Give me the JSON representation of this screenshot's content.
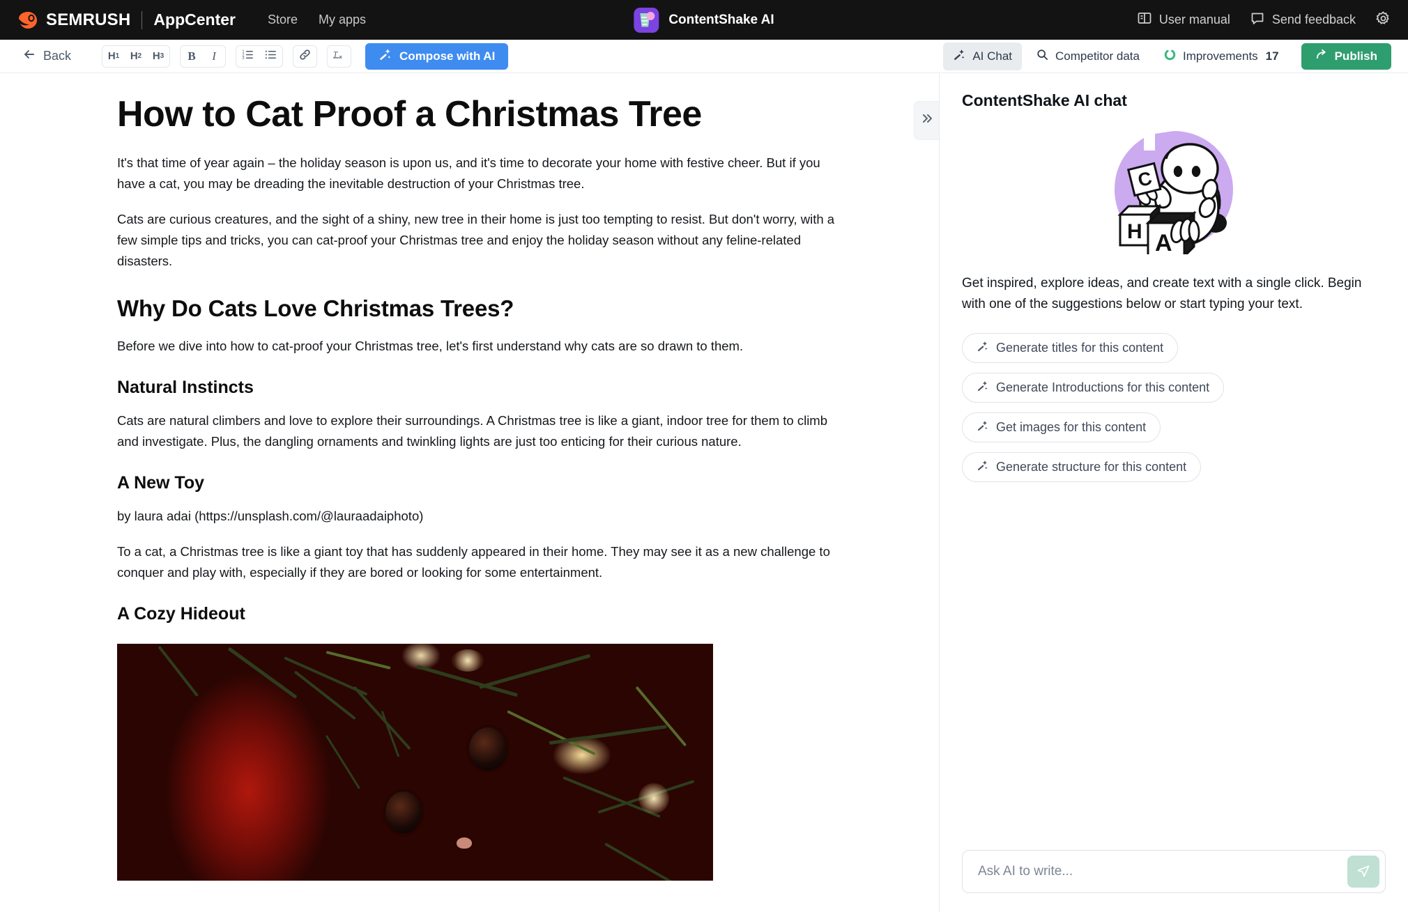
{
  "topnav": {
    "brand_word": "SEMRUSH",
    "appcenter": "AppCenter",
    "links": [
      {
        "label": "Store",
        "name": "nav-link-store"
      },
      {
        "label": "My apps",
        "name": "nav-link-my-apps"
      }
    ],
    "app_title": "ContentShake AI",
    "right_items": [
      {
        "label": "User manual",
        "icon": "book-icon"
      },
      {
        "label": "Send feedback",
        "icon": "comment-icon"
      }
    ],
    "settings_icon": "gear-icon",
    "app_icon_colors": {
      "bg": "#7b43e0",
      "cup": "#9fd9c3",
      "dot": "#f5a8e0"
    }
  },
  "toolbar": {
    "back_label": "Back",
    "heading_buttons": [
      {
        "label": "H",
        "sub": "1"
      },
      {
        "label": "H",
        "sub": "2"
      },
      {
        "label": "H",
        "sub": "3"
      }
    ],
    "format_buttons": [
      {
        "label": "B",
        "name": "bold-button"
      },
      {
        "label": "I",
        "name": "italic-button"
      }
    ],
    "list_buttons": [
      {
        "icon": "ordered-list-icon"
      },
      {
        "icon": "bullet-list-icon"
      }
    ],
    "link_button": {
      "icon": "link-icon"
    },
    "clear_format_button": {
      "icon": "clear-formatting-icon"
    },
    "compose_label": "Compose with AI",
    "compose_icon": "magic-wand-icon",
    "ai_chat_label": "AI Chat",
    "competitor_data_label": "Competitor data",
    "improvements_label": "Improvements",
    "improvements_count": "17",
    "publish_label": "Publish",
    "accent_blue": "#3f8cf0",
    "accent_green": "#2f9e6f"
  },
  "document": {
    "title": "How to Cat Proof a Christmas Tree",
    "blocks": [
      {
        "type": "p",
        "text": "It's that time of year again – the holiday season is upon us, and it's time to decorate your home with festive cheer. But if you have a cat, you may be dreading the inevitable destruction of your Christmas tree."
      },
      {
        "type": "p",
        "text": "Cats are curious creatures, and the sight of a shiny, new tree in their home is just too tempting to resist. But don't worry, with a few simple tips and tricks, you can cat-proof your Christmas tree and enjoy the holiday season without any feline-related disasters."
      },
      {
        "type": "h2",
        "text": "Why Do Cats Love Christmas Trees?"
      },
      {
        "type": "p",
        "text": "Before we dive into how to cat-proof your Christmas tree, let's first understand why cats are so drawn to them."
      },
      {
        "type": "h3",
        "text": "Natural Instincts"
      },
      {
        "type": "p",
        "text": "Cats are natural climbers and love to explore their surroundings. A Christmas tree is like a giant, indoor tree for them to climb and investigate. Plus, the dangling ornaments and twinkling lights are just too enticing for their curious nature."
      },
      {
        "type": "h3",
        "text": "A New Toy"
      },
      {
        "type": "p",
        "text": "by laura adai (https://unsplash.com/@lauraadaiphoto)"
      },
      {
        "type": "p",
        "text": "To a cat, a Christmas tree is like a giant toy that has suddenly appeared in their home. They may see it as a new challenge to conquer and play with, especially if they are bored or looking for some entertainment."
      },
      {
        "type": "h3",
        "text": "A Cozy Hideout"
      },
      {
        "type": "img",
        "alt": "Close-up of a cream colored cat peeking through Christmas tree branches next to a red ornament"
      }
    ]
  },
  "chat": {
    "collapse_icon": "chevron-double-right-icon",
    "title": "ContentShake AI chat",
    "illustration": "robot-with-letter-blocks",
    "description": "Get inspired, explore ideas, and create text with a single click. Begin with one of the suggestions below or start typing your text.",
    "suggestions": [
      "Generate titles for this content",
      "Generate Introductions for this content",
      "Get images for this content",
      "Generate structure for this content"
    ],
    "input_value": "",
    "input_placeholder": "Ask AI to write...",
    "send_icon": "send-icon",
    "send_bg": "#bfe0d2"
  }
}
